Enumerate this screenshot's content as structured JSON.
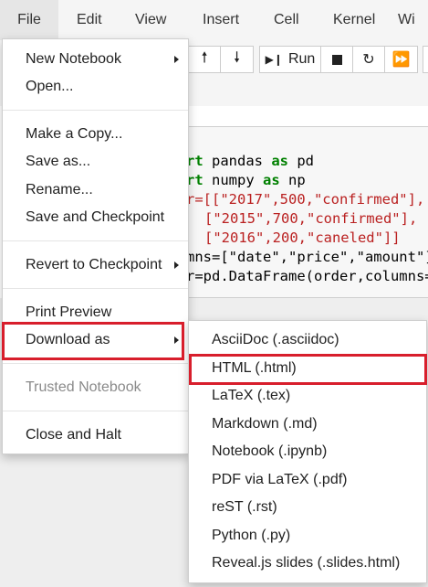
{
  "menubar": {
    "items": [
      "File",
      "Edit",
      "View",
      "Insert",
      "Cell",
      "Kernel",
      "Wi"
    ]
  },
  "toolbar": {
    "run_label": "Run"
  },
  "code": {
    "lines": [
      [
        "rt ",
        "pandas ",
        "as ",
        "pd"
      ],
      [
        "rt ",
        "numpy ",
        "as ",
        "np"
      ],
      [
        "r=[[\"2017\",500,\"confirmed\"],"
      ],
      [
        "[\"2015\",700,\"confirmed\"],"
      ],
      [
        "[\"2016\",200,\"caneled\"]]"
      ],
      [
        "mns=[\"date\",\"price\",\"amount\"]"
      ],
      [
        "r=pd.DataFrame(order,columns=c"
      ]
    ]
  },
  "file_menu": {
    "items": [
      {
        "label": "New Notebook",
        "submenu": true
      },
      {
        "label": "Open..."
      },
      {
        "label": "Make a Copy..."
      },
      {
        "label": "Save as..."
      },
      {
        "label": "Rename..."
      },
      {
        "label": "Save and Checkpoint"
      },
      {
        "label": "Revert to Checkpoint",
        "submenu": true
      },
      {
        "label": "Print Preview"
      },
      {
        "label": "Download as",
        "submenu": true
      },
      {
        "label": "Trusted Notebook",
        "disabled": true
      },
      {
        "label": "Close and Halt"
      }
    ]
  },
  "download_menu": {
    "items": [
      "AsciiDoc (.asciidoc)",
      "HTML (.html)",
      "LaTeX (.tex)",
      "Markdown (.md)",
      "Notebook (.ipynb)",
      "PDF via LaTeX (.pdf)",
      "reST (.rst)",
      "Python (.py)",
      "Reveal.js slides (.slides.html)"
    ]
  },
  "colors": {
    "highlight": "#d81e2c",
    "keyword": "#008000",
    "string": "#ba2121"
  }
}
